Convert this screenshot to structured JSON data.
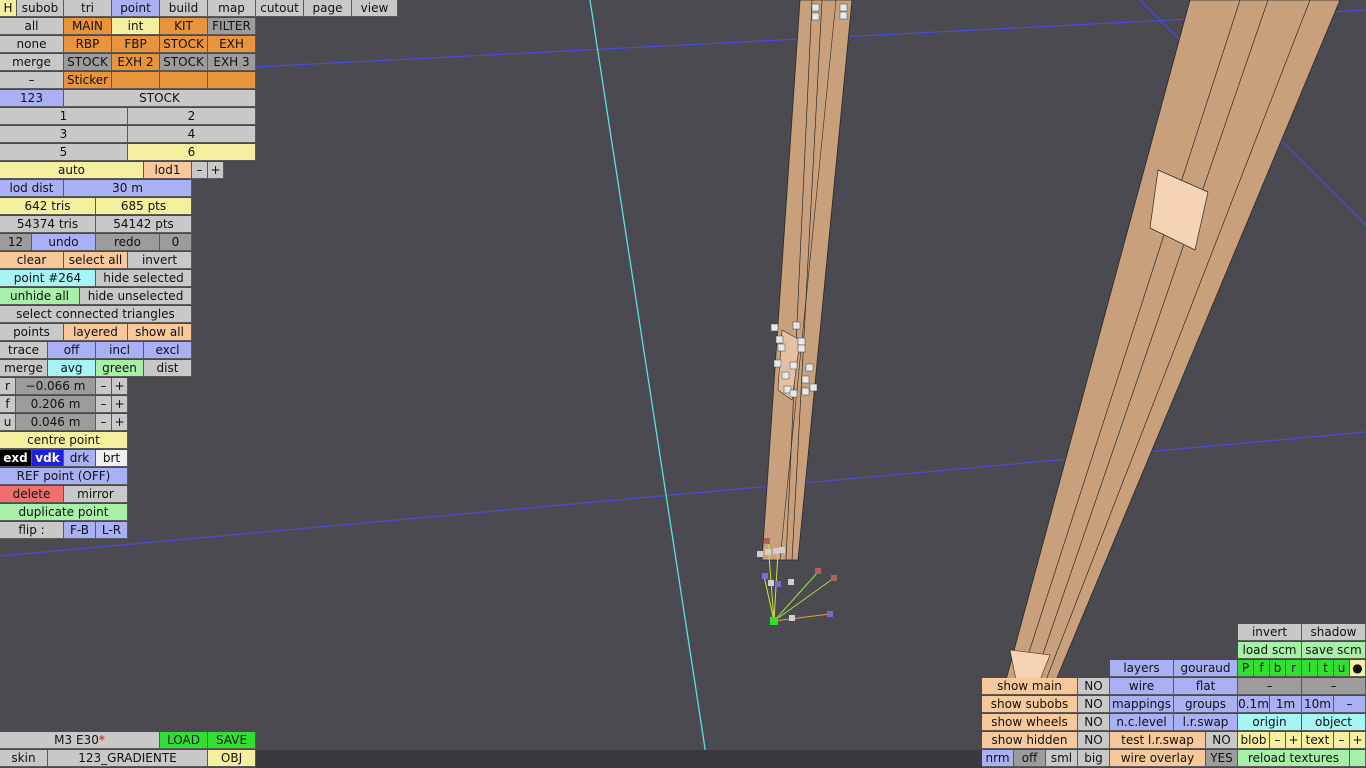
{
  "menu": [
    "H",
    "subob",
    "tri",
    "point",
    "build",
    "map",
    "cutout",
    "page",
    "view"
  ],
  "sel": {
    "r1": [
      "all",
      "MAIN",
      "int",
      "KIT",
      "FILTER"
    ],
    "r2": [
      "none",
      "RBP",
      "FBP",
      "STOCK",
      "EXH"
    ],
    "r3": [
      "merge",
      "STOCK",
      "EXH 2",
      "STOCK",
      "EXH 3"
    ],
    "r4": [
      "–",
      "Sticker"
    ]
  },
  "num": {
    "id": "123",
    "name": "STOCK",
    "n": [
      "1",
      "2",
      "3",
      "4",
      "5",
      "6"
    ]
  },
  "lod": {
    "auto": "auto",
    "level": "lod1",
    "minus": "–",
    "plus": "+",
    "dist_label": "lod dist",
    "dist_value": "30 m"
  },
  "stats": {
    "tris": "642 tris",
    "pts": "685 pts",
    "total_tris": "54374 tris",
    "total_pts": "54142 pts"
  },
  "undo": {
    "count": "12",
    "undo": "undo",
    "redo": "redo",
    "redo_count": "0"
  },
  "selection": {
    "clear": "clear",
    "select_all": "select all",
    "invert": "invert",
    "point": "point #264",
    "hide_selected": "hide selected",
    "unhide_all": "unhide all",
    "hide_unselected": "hide unselected",
    "connected": "select connected triangles"
  },
  "pts": {
    "points": "points",
    "layered": "layered",
    "show_all": "show all"
  },
  "trace": {
    "trace": "trace",
    "off": "off",
    "incl": "incl",
    "excl": "excl"
  },
  "merge": {
    "merge": "merge",
    "avg": "avg",
    "green": "green",
    "dist": "dist"
  },
  "coords": [
    {
      "axis": "r",
      "value": "−0.066 m"
    },
    {
      "axis": "f",
      "value": "0.206 m"
    },
    {
      "axis": "u",
      "value": "0.046 m"
    }
  ],
  "pm": {
    "minus": "–",
    "plus": "+"
  },
  "centre": "centre point",
  "disp": [
    "exd",
    "vdk",
    "drk",
    "brt"
  ],
  "ref": "REF point (OFF)",
  "del": {
    "delete": "delete",
    "mirror": "mirror"
  },
  "dup": "duplicate point",
  "flip": {
    "label": "flip :",
    "fb": "F-B",
    "lr": "L-R"
  },
  "file": {
    "car": "M3 E30",
    "star": "*",
    "load": "LOAD",
    "save": "SAVE",
    "skin_label": "skin",
    "skin": "123_GRADIENTE",
    "obj": "OBJ"
  },
  "br": {
    "invert": "invert",
    "shadow": "shadow",
    "load_scm": "load scm",
    "save_scm": "save scm",
    "letters": [
      "P",
      "f",
      "b",
      "r",
      "l",
      "t",
      "u"
    ],
    "dot": "●",
    "dash": "–",
    "layers": "layers",
    "gouraud": "gouraud",
    "wire": "wire",
    "flat": "flat",
    "mappings": "mappings",
    "groups": "groups",
    "m01": "0.1m",
    "m1": "1m",
    "m10": "10m",
    "nclevel": "n.c.level",
    "lrswap": "l.r.swap",
    "origin": "origin",
    "object": "object",
    "test_lrswap": "test l.r.swap",
    "wire_overlay": "wire overlay",
    "blob": "blob",
    "text": "text",
    "reload": "reload textures",
    "show": [
      {
        "label": "show main",
        "val": "NO"
      },
      {
        "label": "show subobs",
        "val": "NO"
      },
      {
        "label": "show wheels",
        "val": "NO"
      },
      {
        "label": "show hidden",
        "val": "NO"
      }
    ],
    "test_val": "NO",
    "overlay_val": "YES",
    "modes": [
      "nrm",
      "off",
      "sml",
      "big"
    ]
  },
  "colors": {
    "background": "#4a4a50",
    "mesh": "#c8a07c",
    "axis_cyan": "#5ee0e0",
    "axis_blue": "#4a4ae0"
  }
}
